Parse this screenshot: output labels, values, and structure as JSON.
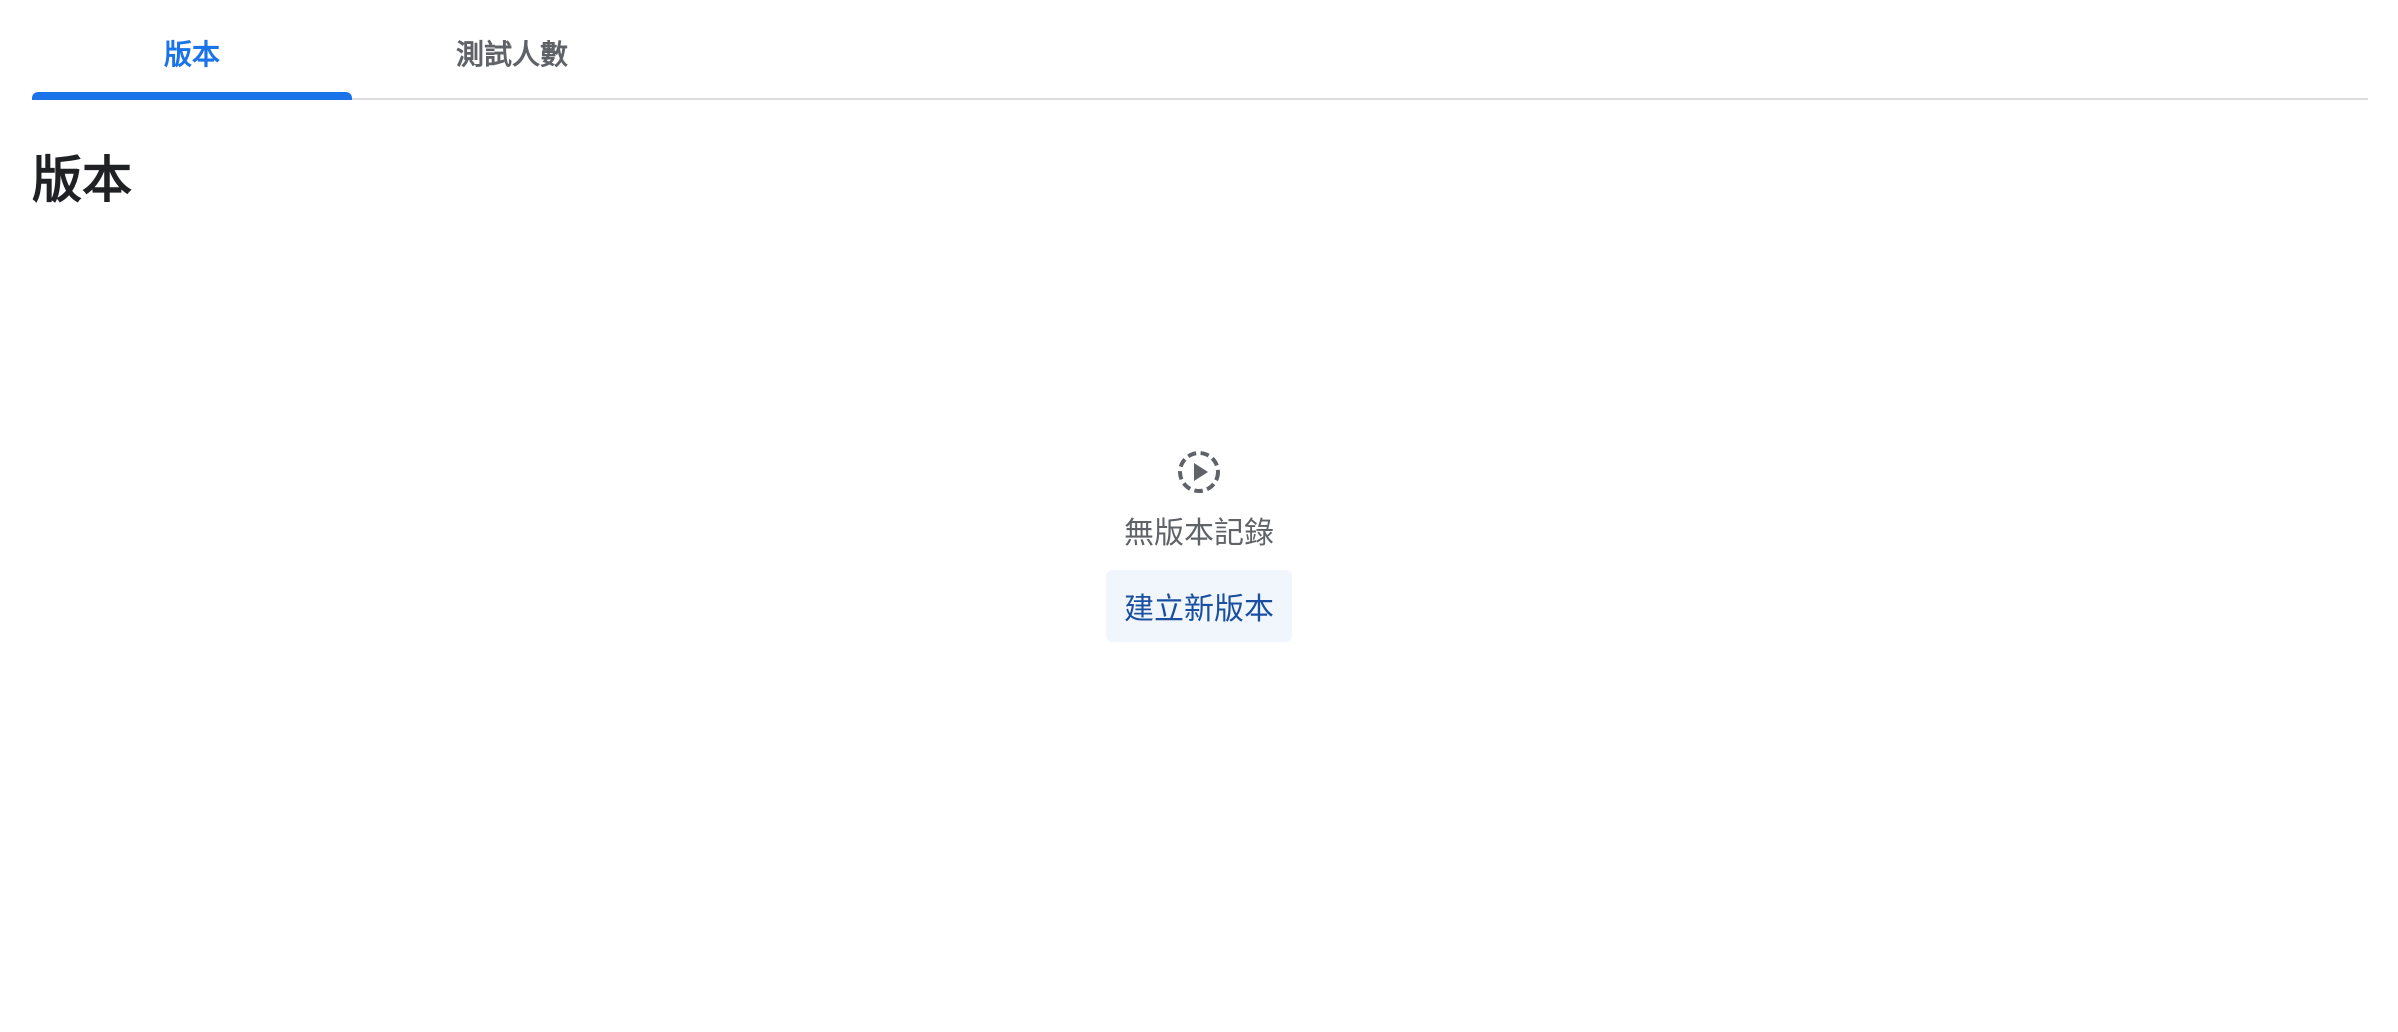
{
  "tabs": [
    {
      "label": "版本",
      "active": true
    },
    {
      "label": "測試人數",
      "active": false
    }
  ],
  "main": {
    "title": "版本",
    "empty_state": {
      "icon": "dashed-circle-play-icon",
      "message": "無版本記錄",
      "action_label": "建立新版本"
    }
  },
  "colors": {
    "accent": "#1a73e8",
    "button_bg": "#f1f6fd",
    "button_text": "#1a4fa0",
    "muted_text": "#5f6368",
    "title_text": "#202124"
  }
}
